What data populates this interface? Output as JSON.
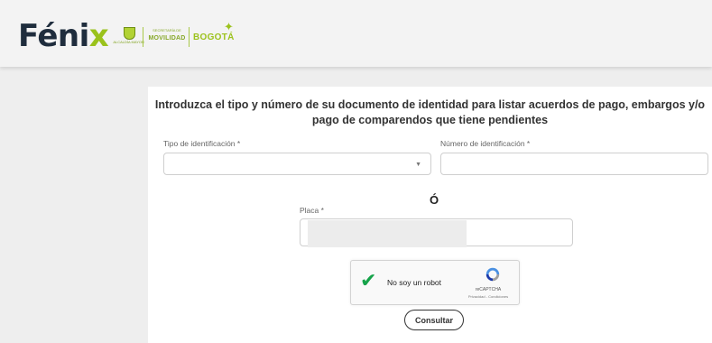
{
  "header": {
    "logo_main": "Féni",
    "logo_accent": "x",
    "seal_text": "ALCALDÍA MAYOR",
    "movilidad_small": "SECRETARÍA DE",
    "movilidad_big": "MOVILIDAD",
    "bogota": "BOGOTÁ"
  },
  "form": {
    "intro": "Introduzca el tipo y número de su documento de identidad para listar acuerdos de pago, embargos y/o pago de comparendos que tiene pendientes",
    "tipo_label": "Tipo de identificación *",
    "tipo_value": "",
    "numero_label": "Número de identificación *",
    "numero_value": "",
    "or_text": "Ó",
    "placa_label": "Placa *",
    "placa_value": "",
    "captcha_label": "No soy un robot",
    "captcha_brand": "reCAPTCHA",
    "captcha_links": "Privacidad - Condiciones",
    "submit_label": "Consultar"
  },
  "colors": {
    "brand_dark": "#1f2d3d",
    "brand_green": "#9ac21c",
    "check_green": "#16a34a"
  }
}
